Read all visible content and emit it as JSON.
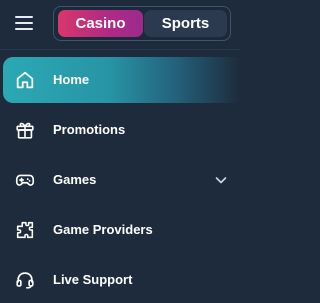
{
  "toggle": {
    "casino_label": "Casino",
    "sports_label": "Sports",
    "selected": "Casino"
  },
  "nav": {
    "items": [
      {
        "label": "Home",
        "icon": "home-icon",
        "active": true
      },
      {
        "label": "Promotions",
        "icon": "gift-icon"
      },
      {
        "label": "Games",
        "icon": "gamepad-icon",
        "expandable": true
      },
      {
        "label": "Game Providers",
        "icon": "puzzle-icon"
      },
      {
        "label": "Live Support",
        "icon": "headset-icon"
      }
    ]
  },
  "colors": {
    "background": "#1e2b3c",
    "casino_accent": "#d8376b",
    "active_item": "#2ba9b5"
  }
}
